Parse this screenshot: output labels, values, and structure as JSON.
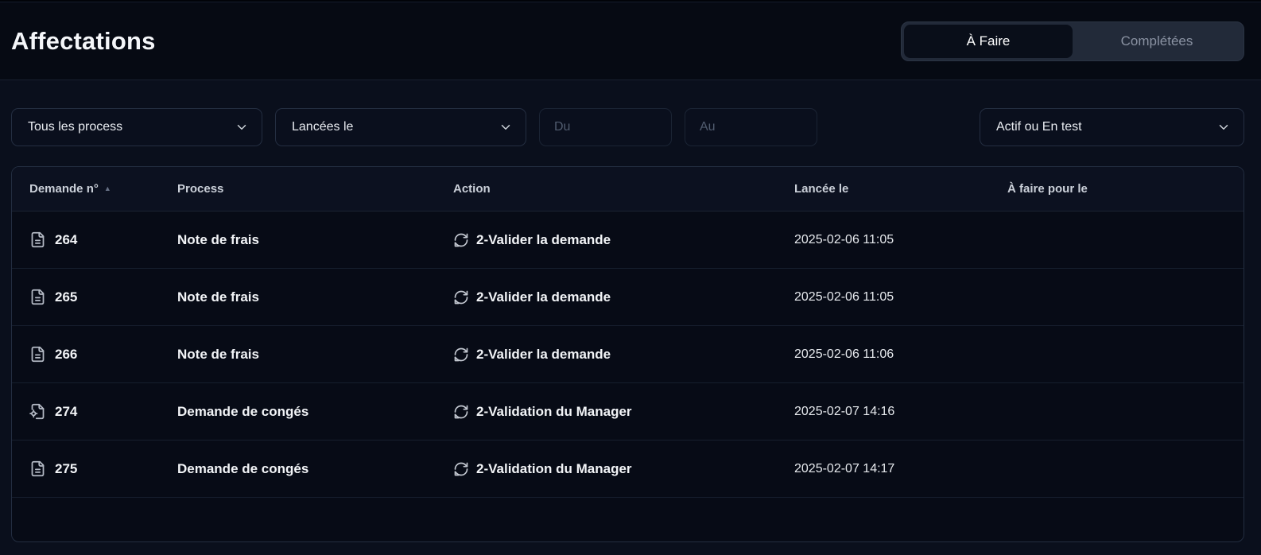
{
  "header": {
    "title": "Affectations",
    "tabs": [
      {
        "label": "À Faire",
        "active": true
      },
      {
        "label": "Complétées",
        "active": false
      }
    ]
  },
  "filters": {
    "process_select": "Tous les process",
    "launched_select": "Lancées le",
    "date_from_placeholder": "Du",
    "date_to_placeholder": "Au",
    "status_select": "Actif ou En test"
  },
  "table": {
    "columns": [
      "Demande n°",
      "Process",
      "Action",
      "Lancée le",
      "À faire pour le"
    ],
    "sort": {
      "column": "Demande n°",
      "direction": "asc",
      "indicator": "▲"
    },
    "rows": [
      {
        "id": "264",
        "icon": "file-text-icon",
        "process": "Note de frais",
        "action": "2-Valider la demande",
        "launched": "2025-02-06 11:05",
        "due": ""
      },
      {
        "id": "265",
        "icon": "file-text-icon",
        "process": "Note de frais",
        "action": "2-Valider la demande",
        "launched": "2025-02-06 11:05",
        "due": ""
      },
      {
        "id": "266",
        "icon": "file-text-icon",
        "process": "Note de frais",
        "action": "2-Valider la demande",
        "launched": "2025-02-06 11:06",
        "due": ""
      },
      {
        "id": "274",
        "icon": "file-cog-icon",
        "process": "Demande de congés",
        "action": "2-Validation du Manager",
        "launched": "2025-02-07 14:16",
        "due": ""
      },
      {
        "id": "275",
        "icon": "file-text-icon",
        "process": "Demande de congés",
        "action": "2-Validation du Manager",
        "launched": "2025-02-07 14:17",
        "due": ""
      }
    ]
  },
  "colors": {
    "background": "#0a0f1c",
    "panel": "#070b16",
    "panel_border": "#232d40",
    "toggle_bg": "#222a39",
    "active_tab_bg": "#090e19",
    "text_primary": "#f2f4f7",
    "text_muted": "#8a92a2",
    "header_row_bg": "#0c1120"
  }
}
